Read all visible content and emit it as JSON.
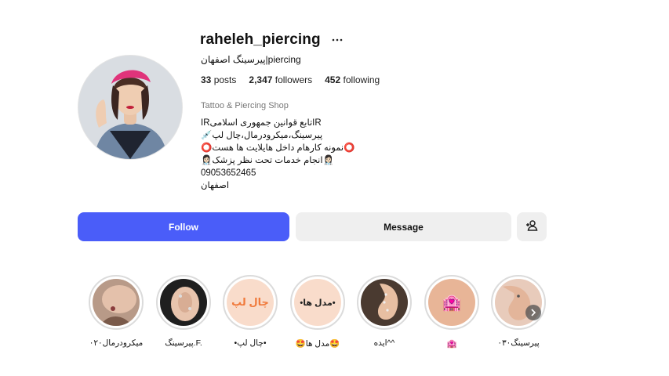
{
  "profile": {
    "username": "raheleh_piercing",
    "full_name": "پیرسینگ اصفهان|piercing",
    "stats": {
      "posts": "33",
      "posts_label": "posts",
      "followers": "2,347",
      "followers_label": "followers",
      "following": "452",
      "following_label": "following"
    },
    "category": "Tattoo & Piercing Shop",
    "bio_lines": [
      "IRتابع قوانین جمهوری اسلامیIR",
      "💉پیرسینگ،میکرودرمال،چال لپ",
      "⭕نمونه کارهام داخل هایلایت ها هست⭕",
      "👩🏻‍⚕️انجام خدمات تحت نظر پزشک👩🏻‍⚕️",
      "09053652465",
      "اصفهان"
    ]
  },
  "actions": {
    "follow_label": "Follow",
    "message_label": "Message"
  },
  "highlights": [
    {
      "label": "میکرودرمال۰۲۰",
      "cover_text": ""
    },
    {
      "label": "پیرسینگ.F.",
      "cover_text": ""
    },
    {
      "label": "•چال لپ•",
      "cover_text": "چال لپ"
    },
    {
      "label": "🤩مدل ها🤩",
      "cover_text": "•مدل ها•"
    },
    {
      "label": "ایده^^",
      "cover_text": ""
    },
    {
      "label": "🏩",
      "cover_text": "🏩"
    },
    {
      "label": "پیرسینگ۰۳۰",
      "cover_text": ""
    }
  ],
  "colors": {
    "follow_button": "#4a5df9",
    "secondary_button": "#efefef",
    "highlight_peach": "#f9dccb",
    "cover_text_color": "#f07a3c"
  },
  "icons": {
    "more": "more-horizontal-icon",
    "add_user": "add-user-icon",
    "next": "chevron-right-icon"
  }
}
